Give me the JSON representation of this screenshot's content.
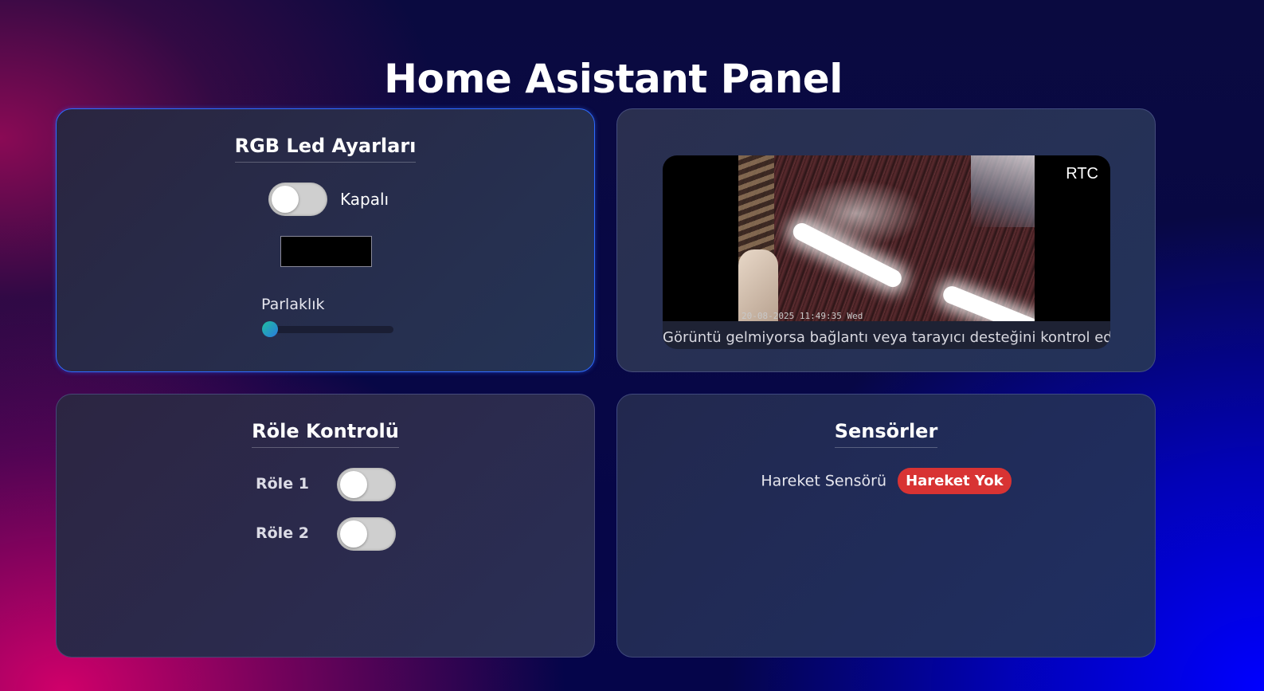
{
  "page": {
    "title": "Home Asistant Panel"
  },
  "rgb_card": {
    "title": "RGB Led Ayarları",
    "toggle_status": "Kapalı",
    "toggle_on": false,
    "color_value": "#000000",
    "brightness_label": "Parlaklık",
    "brightness_value": 0
  },
  "camera_card": {
    "overlay_label": "RTC",
    "timestamp": "20-08-2025 11:49:35 Wed",
    "caption": "Görüntü gelmiyorsa bağlantı veya tarayıcı desteğini kontrol edin"
  },
  "relay_card": {
    "title": "Röle Kontrolü",
    "relays": [
      {
        "label": "Röle 1",
        "on": false
      },
      {
        "label": "Röle 2",
        "on": false
      }
    ]
  },
  "sensor_card": {
    "title": "Sensörler",
    "motion_label": "Hareket Sensörü",
    "motion_status": "Hareket Yok",
    "motion_status_color": "#d83333"
  },
  "colors": {
    "accent_border": "#2e6bff",
    "toggle_off": "#cfcfcf"
  }
}
